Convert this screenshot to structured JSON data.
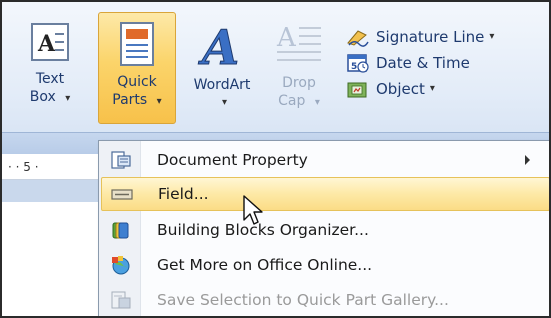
{
  "ribbon": {
    "text_box": {
      "line1": "Text",
      "line2": "Box",
      "arrow": "▾"
    },
    "quick_parts": {
      "line1": "Quick",
      "line2": "Parts",
      "arrow": "▾"
    },
    "wordart": {
      "line1": "WordArt",
      "arrow": "▾"
    },
    "drop_cap": {
      "line1": "Drop",
      "line2": "Cap",
      "arrow": "▾"
    },
    "signature_line": {
      "label": "Signature Line",
      "arrow": "▾"
    },
    "date_time": {
      "label": "Date & Time"
    },
    "object": {
      "label": "Object",
      "arrow": "▾"
    }
  },
  "ruler": {
    "text": "·  ·  5  ·"
  },
  "menu": {
    "items": [
      {
        "label": "Document Property",
        "icon": "document-property-icon",
        "has_submenu": true
      },
      {
        "label": "Field...",
        "icon": "field-icon",
        "highlighted": true
      },
      {
        "label": "Building Blocks Organizer...",
        "icon": "building-blocks-icon"
      },
      {
        "label": "Get More on Office Online...",
        "icon": "office-online-icon"
      },
      {
        "label": "Save Selection to Quick Part Gallery...",
        "icon": "save-selection-icon",
        "disabled": true
      }
    ]
  },
  "colors": {
    "ribbon_text": "#1e3a6e",
    "highlight": "#fbdc86",
    "disabled_text": "#9a9a9a"
  }
}
